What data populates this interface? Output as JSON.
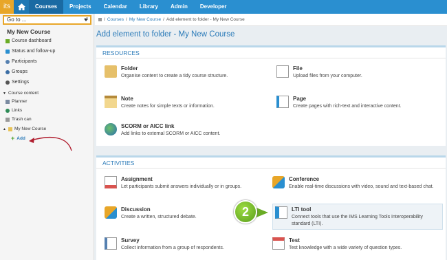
{
  "topbar": {
    "logo": "its",
    "nav": [
      "Courses",
      "Projects",
      "Calendar",
      "Library",
      "Admin",
      "Developer"
    ],
    "active": "Courses"
  },
  "sidebar": {
    "goto": "Go to ...",
    "title": "My New Course",
    "links": [
      "Course dashboard",
      "Status and follow-up",
      "Participants",
      "Groups",
      "Settings"
    ],
    "content_label": "Course content",
    "content_items": [
      "Planner",
      "Links",
      "Trash can"
    ],
    "folder": "My New Course",
    "add": "Add"
  },
  "breadcrumb": {
    "courses": "Courses",
    "course": "My New Course",
    "current": "Add element to folder - My New Course",
    "sep": "/"
  },
  "page_title": "Add element to folder - My New Course",
  "resources": {
    "heading": "RESOURCES",
    "items": [
      {
        "name": "Folder",
        "desc": "Organise content to create a tidy course structure."
      },
      {
        "name": "File",
        "desc": "Upload files from your computer."
      },
      {
        "name": "Note",
        "desc": "Create notes for simple texts or information."
      },
      {
        "name": "Page",
        "desc": "Create pages with rich-text and interactive content."
      },
      {
        "name": "SCORM or AICC link",
        "desc": "Add links to external SCORM or AICC content."
      }
    ]
  },
  "activities": {
    "heading": "ACTIVITIES",
    "items": [
      {
        "name": "Assignment",
        "desc": "Let participants submit answers individually or in groups."
      },
      {
        "name": "Conference",
        "desc": "Enable real-time discussions with video, sound and text-based chat."
      },
      {
        "name": "Discussion",
        "desc": "Create a written, structured debate."
      },
      {
        "name": "LTI tool",
        "desc": "Connect tools that use the IMS Learning Tools Interoperability standard (LTI)."
      },
      {
        "name": "Survey",
        "desc": "Collect information from a group of respondents."
      },
      {
        "name": "Test",
        "desc": "Test knowledge with a wide variety of question types."
      }
    ]
  },
  "annotation": {
    "step": "2"
  },
  "colors": {
    "brand": "#2a8fd0",
    "accent": "#e8a628",
    "link": "#2a7ab8",
    "badge": "#6aac25"
  }
}
